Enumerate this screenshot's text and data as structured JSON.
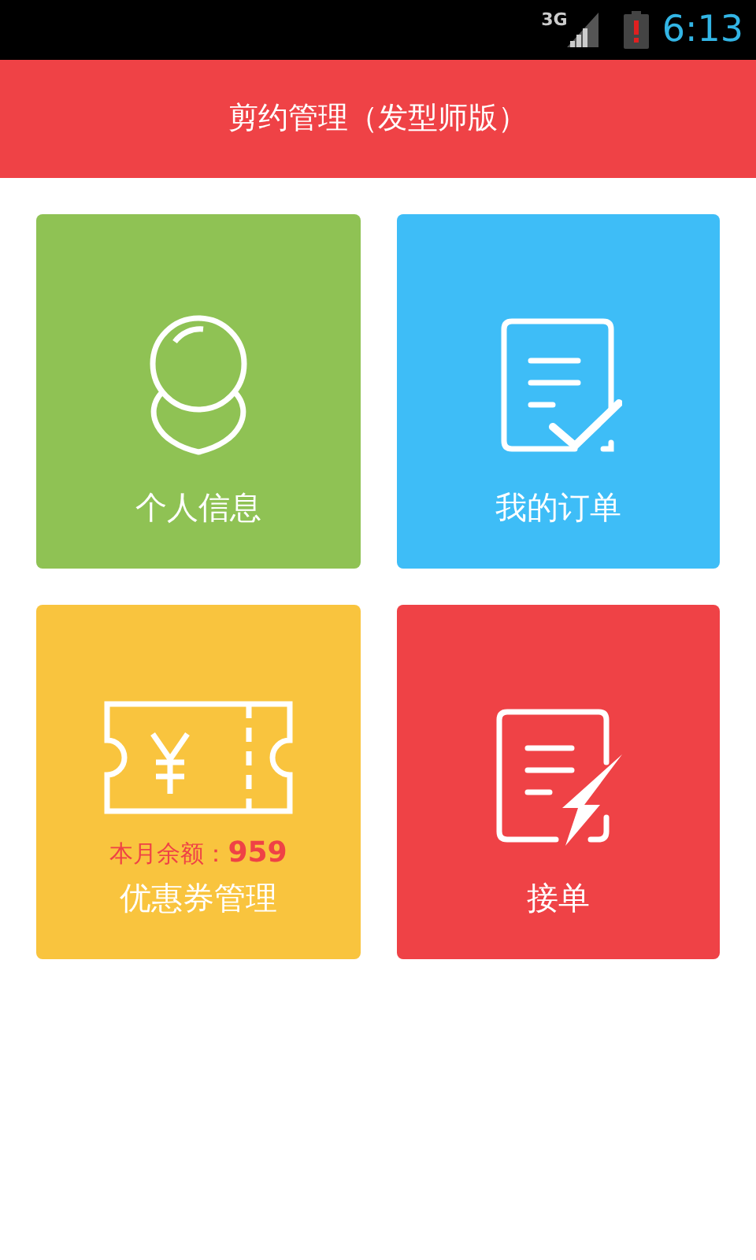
{
  "status_bar": {
    "network": "3G",
    "time": "6:13"
  },
  "header": {
    "title": "剪约管理（发型师版）"
  },
  "tiles": [
    {
      "kind": "profile",
      "label": "个人信息",
      "color": "#8fc254"
    },
    {
      "kind": "orders",
      "label": "我的订单",
      "color": "#3ebdf7"
    },
    {
      "kind": "coupon",
      "label": "优惠券管理",
      "color": "#f9c43e",
      "note": "本月余额：**959**"
    },
    {
      "kind": "accept",
      "label": "接单",
      "color": "#ef4246"
    }
  ]
}
